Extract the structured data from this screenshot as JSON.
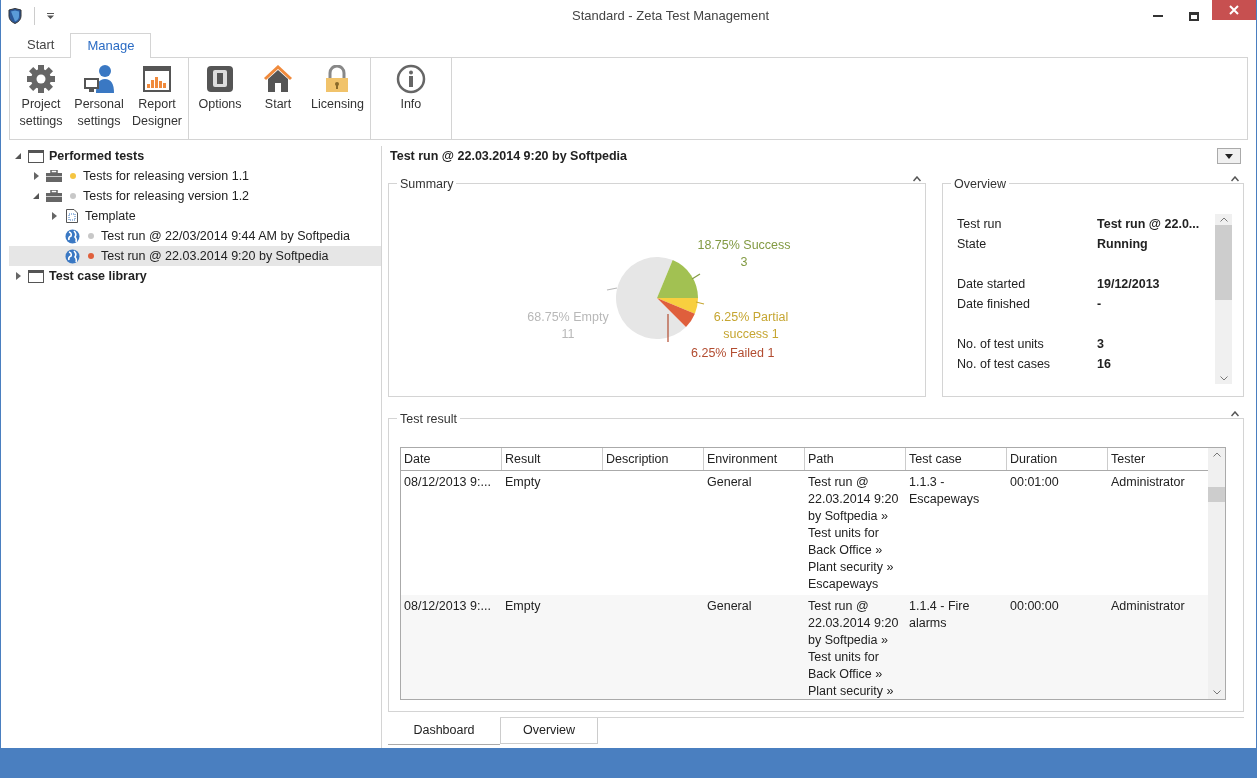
{
  "window": {
    "title": "Standard - Zeta Test Management"
  },
  "ribbon": {
    "tabs": [
      {
        "label": "Start",
        "selected": false
      },
      {
        "label": "Manage",
        "selected": true
      }
    ],
    "groups": [
      [
        {
          "label": "Project\nsettings"
        },
        {
          "label": "Personal\nsettings"
        },
        {
          "label": "Report\nDesigner"
        }
      ],
      [
        {
          "label": "Options"
        },
        {
          "label": "Start"
        },
        {
          "label": "Licensing"
        }
      ],
      [
        {
          "label": "Info"
        }
      ]
    ]
  },
  "tree": [
    {
      "label": "Performed tests",
      "kind": "root",
      "expanded": true,
      "selected": false,
      "children": [
        {
          "label": "Tests for releasing version 1.1",
          "kind": "suite",
          "color": "#f5c542",
          "expanded": false,
          "selected": false
        },
        {
          "label": "Tests for releasing version 1.2",
          "kind": "suite",
          "color": "#c8c8c8",
          "expanded": true,
          "selected": false,
          "children": [
            {
              "label": "Template",
              "kind": "template",
              "expanded": false,
              "selected": false
            },
            {
              "label": "Test run @ 22/03/2014 9:44 AM by Softpedia",
              "kind": "run",
              "color": "#c8c8c8",
              "selected": false
            },
            {
              "label": "Test run @ 22.03.2014 9:20 by Softpedia",
              "kind": "run",
              "color": "#e0603c",
              "selected": true
            }
          ]
        }
      ]
    },
    {
      "label": "Test case library",
      "kind": "root",
      "expanded": false,
      "selected": false
    }
  ],
  "detail": {
    "title": "Test run @ 22.03.2014 9:20 by Softpedia",
    "summary": {
      "title": "Summary",
      "chart_data": {
        "type": "pie",
        "values": [
          68.75,
          18.75,
          6.25,
          6.25
        ],
        "value_labels": [
          "68.75% Empty\n11",
          "18.75% Success\n3",
          "6.25% Partial\nsuccess 1",
          "6.25% Failed 1"
        ]
      }
    },
    "overview": {
      "title": "Overview",
      "groups": [
        [
          {
            "label": "Test run",
            "value": "Test run @ 22.0..."
          },
          {
            "label": "State",
            "value": "Running"
          }
        ],
        [
          {
            "label": "Date started",
            "value": "19/12/2013"
          },
          {
            "label": "Date finished",
            "value": "-"
          }
        ],
        [
          {
            "label": "No. of test units",
            "value": "3"
          },
          {
            "label": "No. of test cases",
            "value": "16"
          }
        ]
      ]
    },
    "test_result": {
      "title": "Test result",
      "columns": [
        "Date",
        "Result",
        "Description",
        "Environment",
        "Path",
        "Test case",
        "Duration",
        "Tester"
      ],
      "rows": [
        [
          "08/12/2013 9:...",
          "Empty",
          "",
          "General",
          "Test run @\n22.03.2014 9:20\nby Softpedia »\nTest units for\nBack Office »\nPlant security »\nEscapeways",
          "1.1.3 -\nEscapeways",
          "00:01:00",
          "Administrator"
        ],
        [
          "08/12/2013 9:...",
          "Empty",
          "",
          "General",
          "Test run @\n22.03.2014 9:20\nby Softpedia »\nTest units for\nBack Office »\nPlant security »",
          "1.1.4 - Fire\nalarms",
          "00:00:00",
          "Administrator"
        ]
      ]
    },
    "tabs": [
      {
        "label": "Dashboard",
        "selected": true
      },
      {
        "label": "Overview",
        "selected": false
      }
    ]
  }
}
